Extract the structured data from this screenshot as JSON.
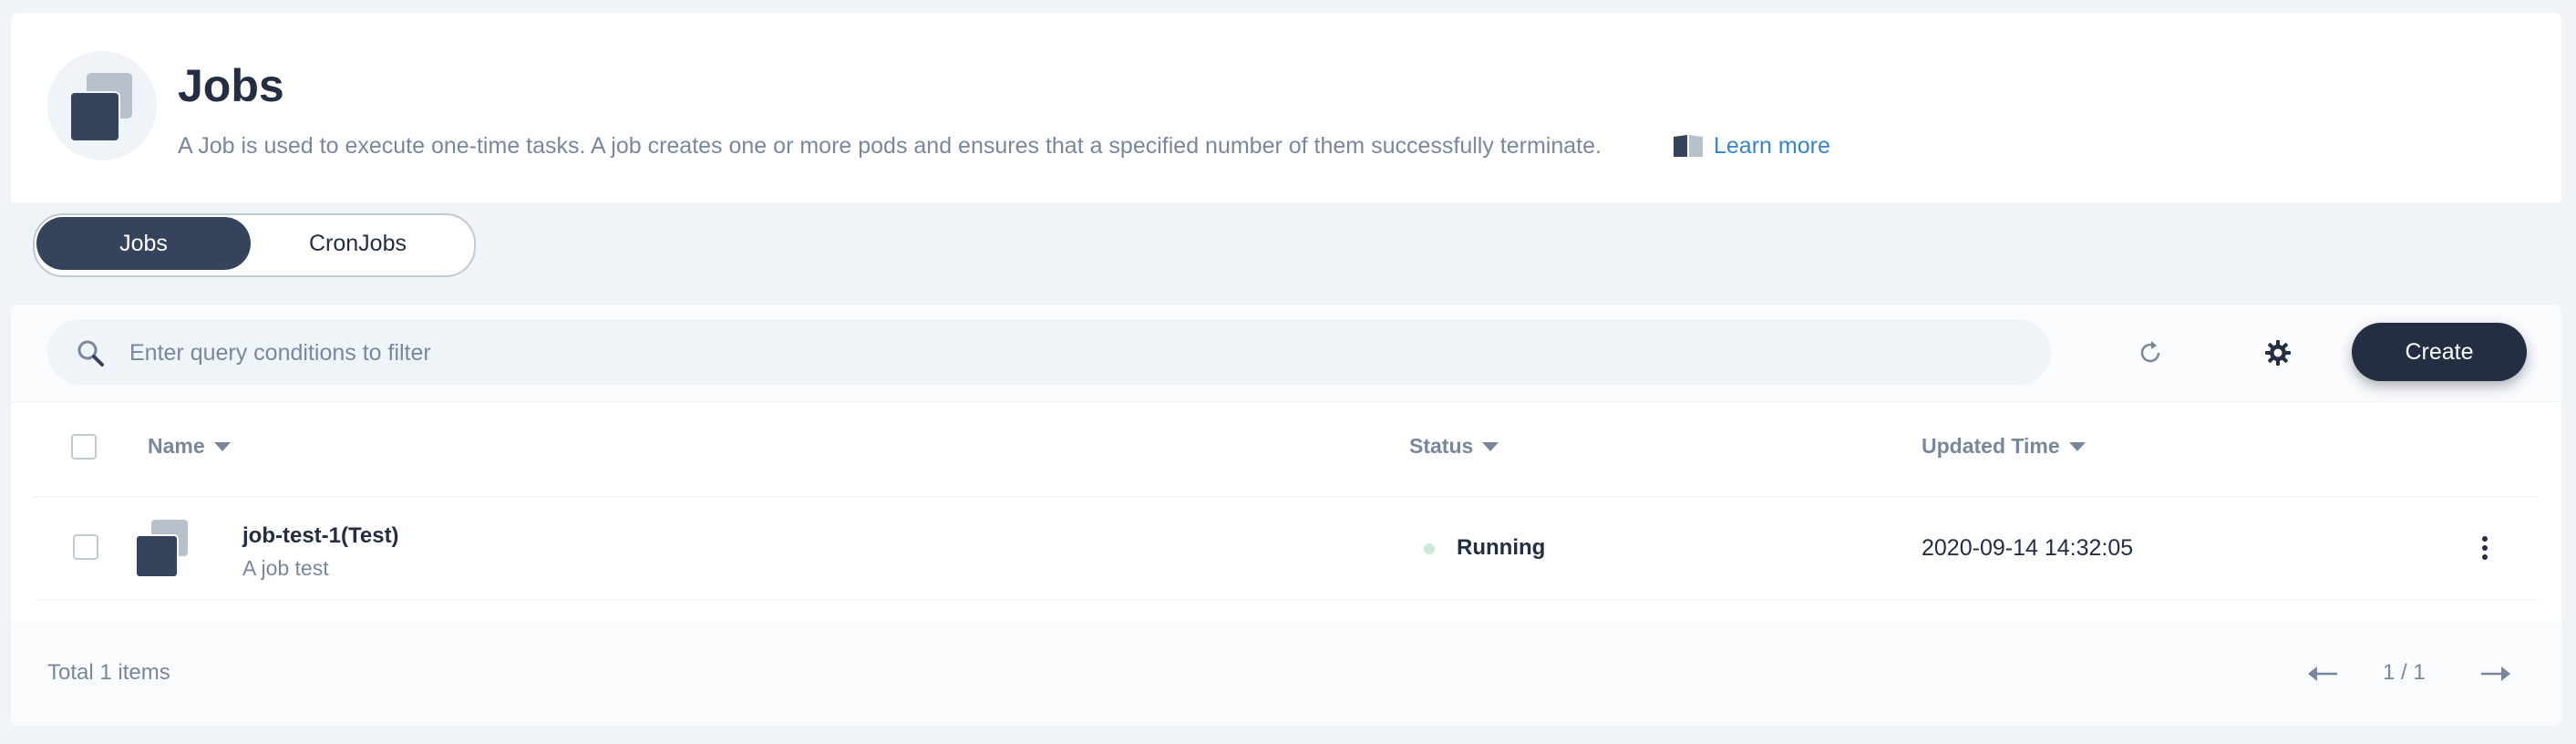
{
  "header": {
    "title": "Jobs",
    "description": "A Job is used to execute one-time tasks. A job creates one or more pods and ensures that a specified number of them successfully terminate.",
    "learn_more": "Learn more",
    "icon": "jobs-icon"
  },
  "tabs": [
    {
      "label": "Jobs",
      "active": true
    },
    {
      "label": "CronJobs",
      "active": false
    }
  ],
  "toolbar": {
    "search_placeholder": "Enter query conditions to filter",
    "create_label": "Create",
    "icons": [
      "search-icon",
      "refresh-icon",
      "settings-icon"
    ]
  },
  "table": {
    "columns": [
      {
        "label": "Name",
        "sortable": true
      },
      {
        "label": "Status",
        "sortable": true
      },
      {
        "label": "Updated Time",
        "sortable": true
      }
    ],
    "rows": [
      {
        "name": "job-test-1(Test)",
        "description": "A job test",
        "status": "Running",
        "updated_time": "2020-09-14 14:32:05"
      }
    ]
  },
  "footer": {
    "total": "Total 1 items",
    "page": "1 / 1"
  },
  "colors": {
    "primary_dark": "#242e42",
    "accent_link": "#3385cc",
    "muted_text": "#79879c",
    "background": "#eff4f9",
    "status_running_dot": "#c9ecd9"
  }
}
